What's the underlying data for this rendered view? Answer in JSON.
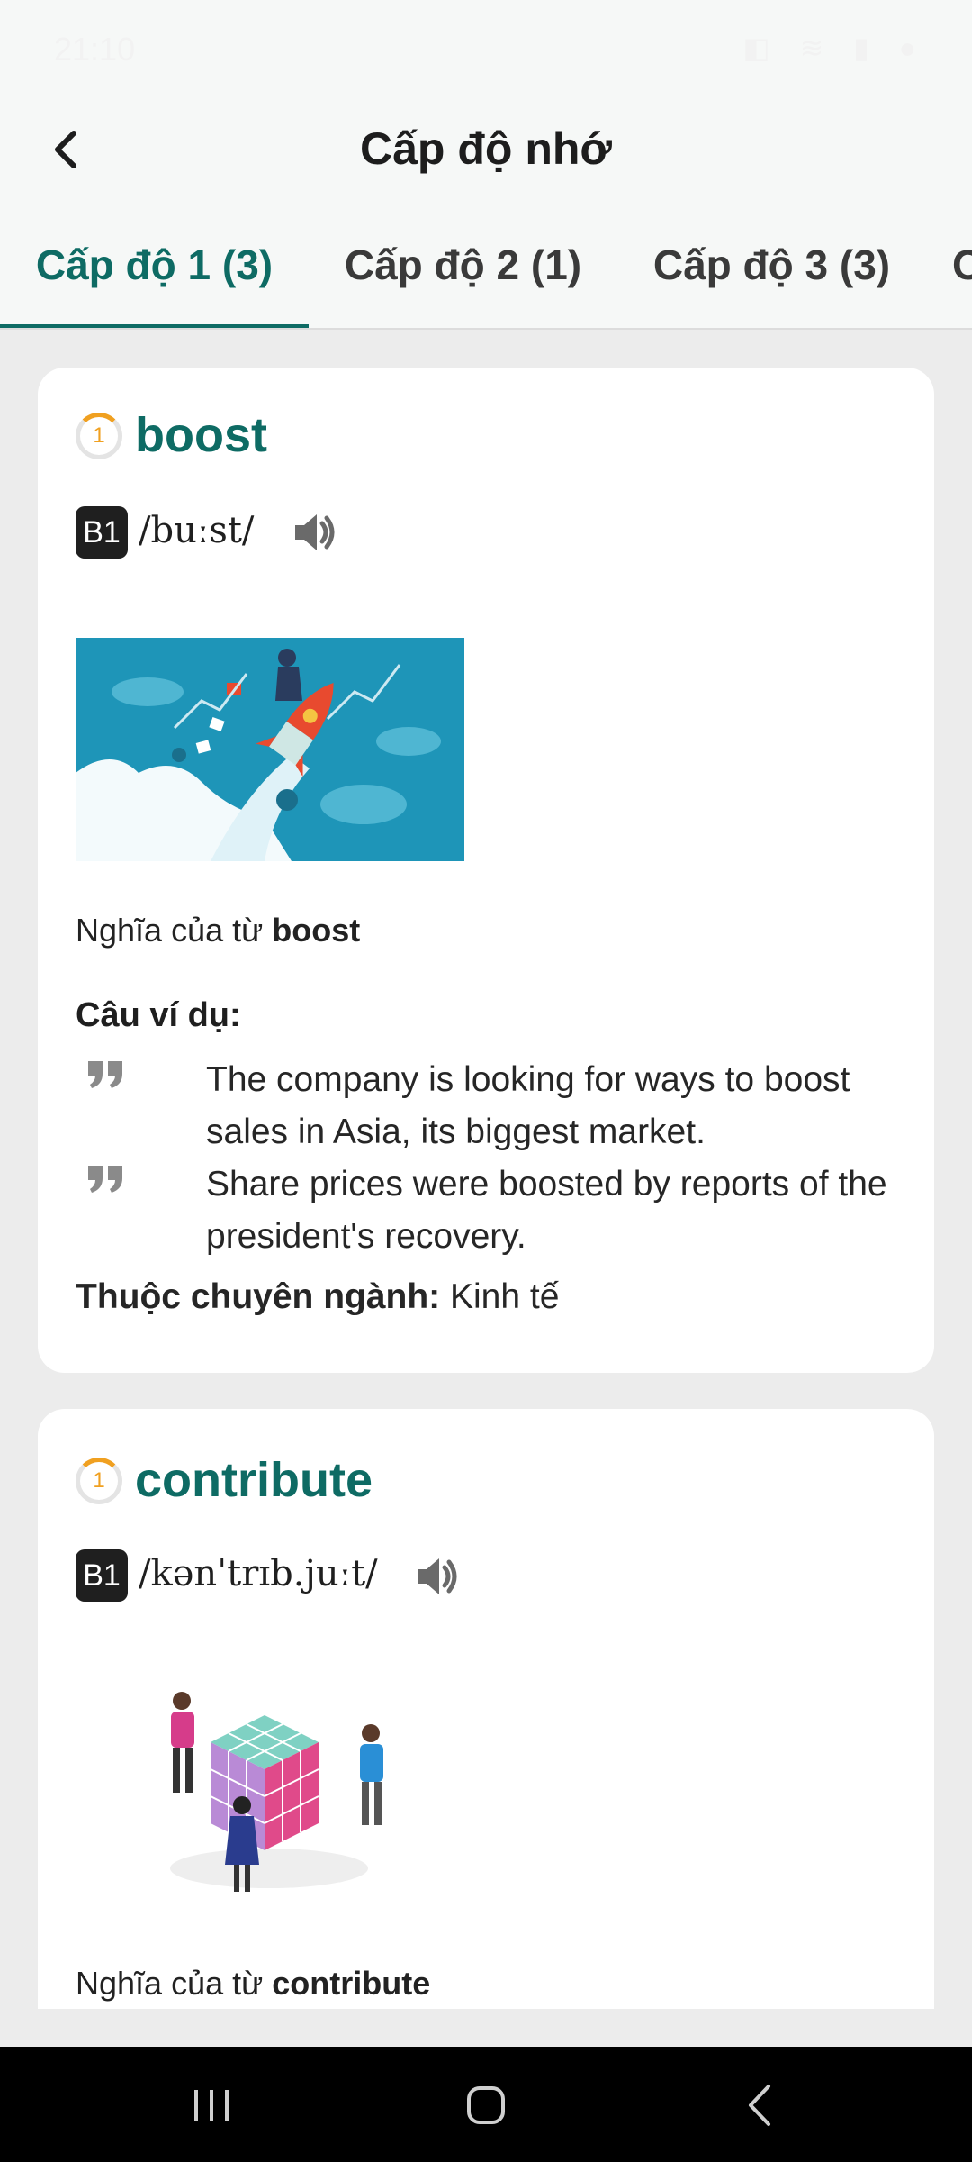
{
  "status_bar": {
    "time": "21:10",
    "icons": "◧ ≋ ▮ ●"
  },
  "header": {
    "title": "Cấp độ nhớ"
  },
  "tabs": [
    {
      "label": "Cấp độ 1 (3)",
      "active": true
    },
    {
      "label": "Cấp độ 2 (1)",
      "active": false
    },
    {
      "label": "Cấp độ 3 (3)",
      "active": false
    },
    {
      "label": "C",
      "active": false
    }
  ],
  "cards": [
    {
      "level": "1",
      "word": "boost",
      "cefr": "B1",
      "ipa": "/buːst/",
      "meaning_prefix": "Nghĩa của từ ",
      "meaning_word": "boost",
      "examples_title": "Câu ví dụ:",
      "examples": [
        "The company is looking for ways to boost sales in Asia, its biggest market.",
        "Share prices were boosted by reports of the president's recovery."
      ],
      "field_label": "Thuộc chuyên ngành:",
      "field_value": " Kinh tế"
    },
    {
      "level": "1",
      "word": "contribute",
      "cefr": "B1",
      "ipa": "/kənˈtrɪb.juːt/",
      "meaning_prefix": "Nghĩa của từ ",
      "meaning_word": "contribute"
    }
  ],
  "icons": {
    "back": "back-arrow-icon",
    "speaker": "speaker-icon",
    "quote": "quote-icon",
    "nav_recents": "recents-icon",
    "nav_home": "home-icon",
    "nav_back": "nav-back-icon"
  },
  "colors": {
    "accent": "#0e6b64",
    "level_ring": "#f0a020",
    "illus_bg": "#1e95b8"
  }
}
